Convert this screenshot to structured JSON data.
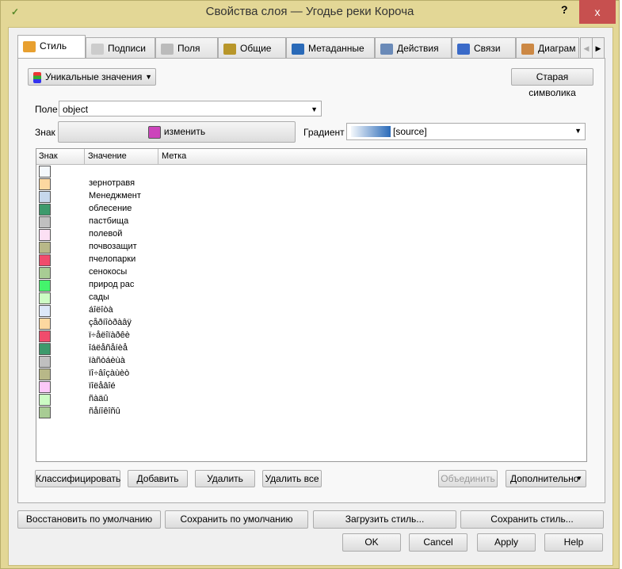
{
  "window": {
    "title": "Свойства слоя — Угодье реки Короча",
    "help": "?",
    "close": "x"
  },
  "tabs": [
    {
      "label": "Стиль",
      "icon": "brush-icon"
    },
    {
      "label": "Подписи",
      "icon": "label-icon"
    },
    {
      "label": "Поля",
      "icon": "table-icon"
    },
    {
      "label": "Общие",
      "icon": "tools-icon"
    },
    {
      "label": "Метаданные",
      "icon": "info-icon"
    },
    {
      "label": "Действия",
      "icon": "gears-icon"
    },
    {
      "label": "Связи",
      "icon": "join-icon"
    },
    {
      "label": "Диаграм",
      "icon": "diagram-icon"
    }
  ],
  "style": {
    "renderer": "Уникальные значения",
    "old_symbology": "Старая символика",
    "field_label": "Поле",
    "field_value": "object",
    "symbol_label": "Знак",
    "symbol_change": "изменить",
    "symbol_color": "#cc44bb",
    "gradient_label": "Градиент",
    "gradient_value": "[source]",
    "columns": [
      "Знак",
      "Значение",
      "Метка"
    ],
    "rows": [
      {
        "color": "#f4f8fc",
        "value": ""
      },
      {
        "color": "#fcd8a0",
        "value": "зернотравя"
      },
      {
        "color": "#c6d8ec",
        "value": "Менеджмент"
      },
      {
        "color": "#3d9a6c",
        "value": "облесение"
      },
      {
        "color": "#c0c0c0",
        "value": "пастбища"
      },
      {
        "color": "#fce0f4",
        "value": "полевой"
      },
      {
        "color": "#b8b888",
        "value": "почвозащит"
      },
      {
        "color": "#f04c6c",
        "value": "пчелопарки"
      },
      {
        "color": "#a8cc94",
        "value": "сенокосы"
      },
      {
        "color": "#44f46c",
        "value": "природ рас"
      },
      {
        "color": "#ccfcc4",
        "value": "сады"
      },
      {
        "color": "#dce8f8",
        "value": "áîëîòà"
      },
      {
        "color": "#fcd8a0",
        "value": "çåðíîòðàâÿ"
      },
      {
        "color": "#f04c6c",
        "value": "ï÷åëîïàðêè"
      },
      {
        "color": "#3d9a6c",
        "value": "îáëåñåíèå"
      },
      {
        "color": "#c0c0c0",
        "value": "ïàñòáèùà"
      },
      {
        "color": "#b8b888",
        "value": "ïî÷âîçàùèò"
      },
      {
        "color": "#fcc8f8",
        "value": "ïîëåâîé"
      },
      {
        "color": "#ccfcc4",
        "value": "ñàäû"
      },
      {
        "color": "#a8cc94",
        "value": "ñåíîêîñû"
      }
    ],
    "buttons": {
      "classify": "Классифицировать",
      "add": "Добавить",
      "delete": "Удалить",
      "delete_all": "Удалить все",
      "merge": "Объединить",
      "advanced": "Дополнительно"
    }
  },
  "footer": {
    "restore": "Восстановить по умолчанию",
    "save_default": "Сохранить по умолчанию",
    "load": "Загрузить стиль...",
    "save": "Сохранить стиль...",
    "ok": "OK",
    "cancel": "Cancel",
    "apply": "Apply",
    "help": "Help"
  }
}
